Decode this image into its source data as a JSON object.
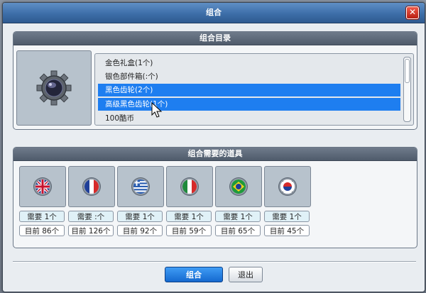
{
  "window": {
    "title": "组合"
  },
  "catalog": {
    "header": "组合目录",
    "items": [
      {
        "label": "金色礼盒(1个)",
        "selected": false
      },
      {
        "label": "银色部件箱(:个)",
        "selected": false
      },
      {
        "label": "黑色齿轮(2个)",
        "selected": true
      },
      {
        "label": "高级黑色齿轮(1个)",
        "selected": true
      },
      {
        "label": "100酷币",
        "selected": false
      }
    ]
  },
  "materials": {
    "header": "组合需要的道具",
    "slots": [
      {
        "flag": "uk-flag-icon",
        "need": "需要 1个",
        "have": "目前 86个"
      },
      {
        "flag": "france-flag-icon",
        "need": "需要 :个",
        "have": "目前 126个"
      },
      {
        "flag": "greece-flag-icon",
        "need": "需要 1个",
        "have": "目前 92个"
      },
      {
        "flag": "italy-flag-icon",
        "need": "需要 1个",
        "have": "目前 59个"
      },
      {
        "flag": "brazil-flag-icon",
        "need": "需要 1个",
        "have": "目前 65个"
      },
      {
        "flag": "korea-flag-icon",
        "need": "需要 1个",
        "have": "目前 45个"
      }
    ]
  },
  "buttons": {
    "combine": "组合",
    "exit": "退出"
  },
  "colors": {
    "selection": "#1e7ef0",
    "titlebar": "#3d6ea8",
    "close": "#d0392b"
  },
  "icons": {
    "close": "close-icon",
    "preview": "gear-icon",
    "pointer": "cursor-icon"
  }
}
